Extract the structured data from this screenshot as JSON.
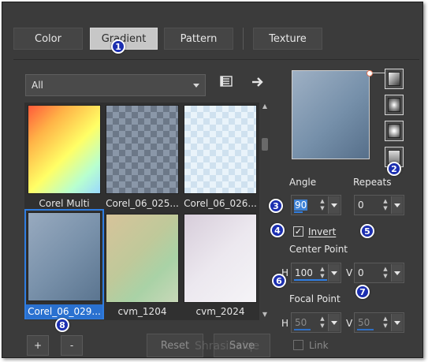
{
  "tabs": [
    {
      "label": "Color",
      "active": false
    },
    {
      "label": "Gradient",
      "active": true
    },
    {
      "label": "Pattern",
      "active": false
    },
    {
      "label": "Texture",
      "active": false
    }
  ],
  "library": {
    "category_selected": "All",
    "thumbnails": [
      {
        "label": "Corel Multi",
        "selected": false
      },
      {
        "label": "Corel_06_025...",
        "selected": false
      },
      {
        "label": "Corel_06_026...",
        "selected": false
      },
      {
        "label": "Corel_06_029...",
        "selected": true
      },
      {
        "label": "cvm_1204",
        "selected": false
      },
      {
        "label": "cvm_2024",
        "selected": false
      }
    ]
  },
  "buttons": {
    "add": "+",
    "remove": "-",
    "reset": "Reset",
    "save": "Save"
  },
  "controls": {
    "angle_label": "Angle",
    "angle_value": "90",
    "angle_fill": 0.25,
    "repeats_label": "Repeats",
    "repeats_value": "0",
    "invert_label": "Invert",
    "invert_checked": true,
    "center_point_label": "Center Point",
    "center_h_label": "H",
    "center_h_value": "100",
    "center_h_fill": 1.0,
    "center_v_label": "V",
    "center_v_value": "0",
    "center_v_fill": 0.0,
    "focal_point_label": "Focal Point",
    "focal_h_label": "H",
    "focal_h_value": "50",
    "focal_h_fill": 0.5,
    "focal_v_label": "V",
    "focal_v_value": "50",
    "focal_v_fill": 0.5,
    "link_label": "Link",
    "link_checked": false
  },
  "callouts": [
    "1",
    "2",
    "3",
    "4",
    "5",
    "6",
    "7",
    "8"
  ],
  "watermark": "Shrasinaiqe",
  "icons": {
    "library_icon": "gradient-library-icon",
    "export_icon": "arrow-right-icon"
  },
  "colors": {
    "panel_bg": "#3b3b3b",
    "accent": "#2f7de1",
    "badge": "#1c2fb0",
    "gradient_start": "#9eb0c4",
    "gradient_end": "#566f8a"
  }
}
